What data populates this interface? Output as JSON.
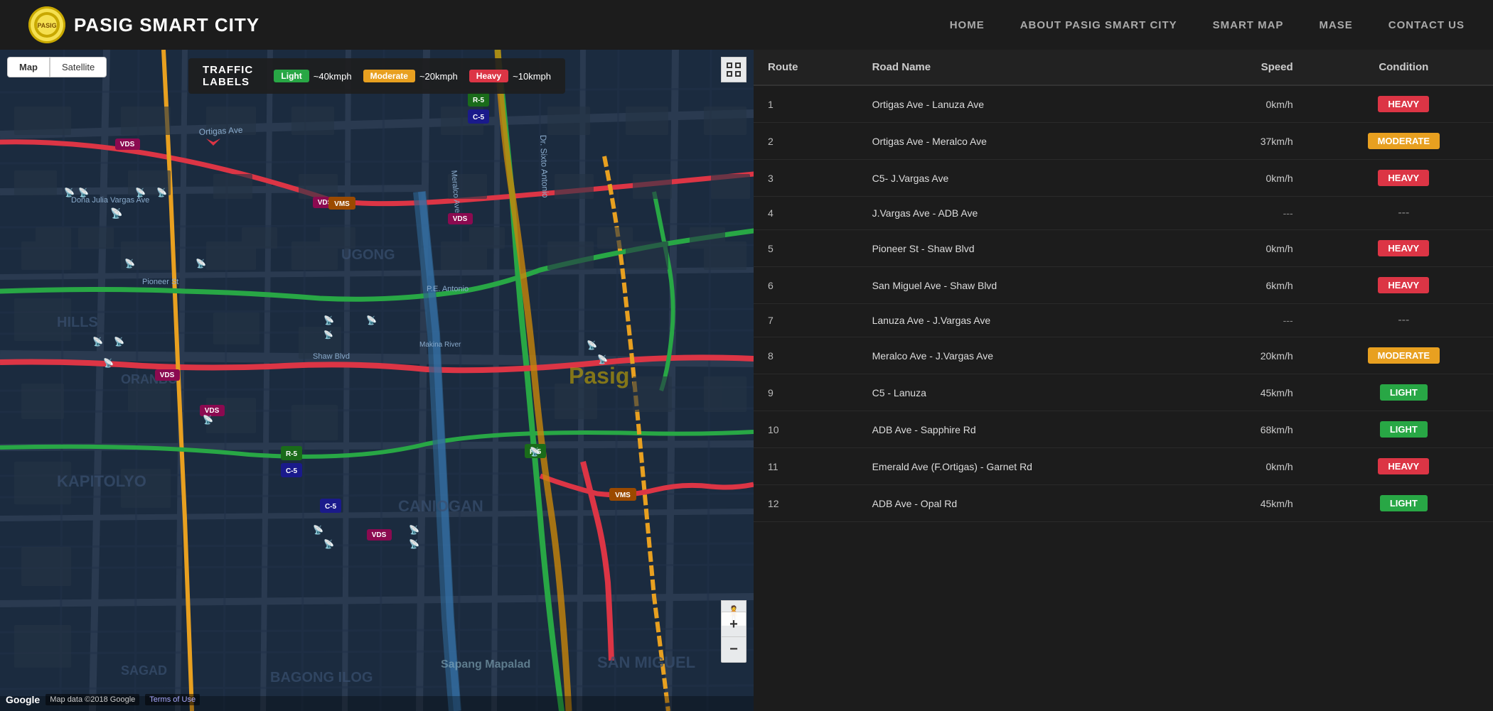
{
  "header": {
    "brand": "PASIG SMART CITY",
    "nav": [
      {
        "label": "HOME",
        "id": "home"
      },
      {
        "label": "ABOUT PASIG SMART CITY",
        "id": "about"
      },
      {
        "label": "SMART MAP",
        "id": "smart-map"
      },
      {
        "label": "MASE",
        "id": "mase"
      },
      {
        "label": "CONTACT US",
        "id": "contact"
      }
    ]
  },
  "map": {
    "toggle_map": "Map",
    "toggle_satellite": "Satellite",
    "traffic_title": "TRAFFIC LABELS",
    "labels": [
      {
        "name": "Light",
        "speed": "~40kmph",
        "color": "#28a745"
      },
      {
        "name": "Moderate",
        "speed": "~20kmph",
        "color": "#e8a020"
      },
      {
        "name": "Heavy",
        "speed": "~10kmph",
        "color": "#dc3545"
      }
    ],
    "attribution": "Map data ©2018 Google",
    "terms": "Terms of Use",
    "google_logo": "Google"
  },
  "table": {
    "headers": [
      "Route",
      "Road Name",
      "Speed",
      "Condition"
    ],
    "rows": [
      {
        "route": "1",
        "road": "Ortigas Ave - Lanuza Ave",
        "speed": "0km/h",
        "condition": "HEAVY",
        "cond_class": "cond-heavy"
      },
      {
        "route": "2",
        "road": "Ortigas Ave - Meralco Ave",
        "speed": "37km/h",
        "condition": "MODERATE",
        "cond_class": "cond-moderate"
      },
      {
        "route": "3",
        "road": "C5- J.Vargas Ave",
        "speed": "0km/h",
        "condition": "HEAVY",
        "cond_class": "cond-heavy"
      },
      {
        "route": "4",
        "road": "J.Vargas Ave - ADB Ave",
        "speed": "---",
        "condition": "---",
        "cond_class": "cond-dash"
      },
      {
        "route": "5",
        "road": "Pioneer St - Shaw Blvd",
        "speed": "0km/h",
        "condition": "HEAVY",
        "cond_class": "cond-heavy"
      },
      {
        "route": "6",
        "road": "San Miguel Ave - Shaw Blvd",
        "speed": "6km/h",
        "condition": "HEAVY",
        "cond_class": "cond-heavy"
      },
      {
        "route": "7",
        "road": "Lanuza Ave - J.Vargas Ave",
        "speed": "---",
        "condition": "---",
        "cond_class": "cond-dash"
      },
      {
        "route": "8",
        "road": "Meralco Ave - J.Vargas Ave",
        "speed": "20km/h",
        "condition": "MODERATE",
        "cond_class": "cond-moderate"
      },
      {
        "route": "9",
        "road": "C5 - Lanuza",
        "speed": "45km/h",
        "condition": "LIGHT",
        "cond_class": "cond-light"
      },
      {
        "route": "10",
        "road": "ADB Ave - Sapphire Rd",
        "speed": "68km/h",
        "condition": "LIGHT",
        "cond_class": "cond-light"
      },
      {
        "route": "11",
        "road": "Emerald Ave (F.Ortigas) - Garnet Rd",
        "speed": "0km/h",
        "condition": "HEAVY",
        "cond_class": "cond-heavy"
      },
      {
        "route": "12",
        "road": "ADB Ave - Opal Rd",
        "speed": "45km/h",
        "condition": "LIGHT",
        "cond_class": "cond-light"
      }
    ]
  }
}
